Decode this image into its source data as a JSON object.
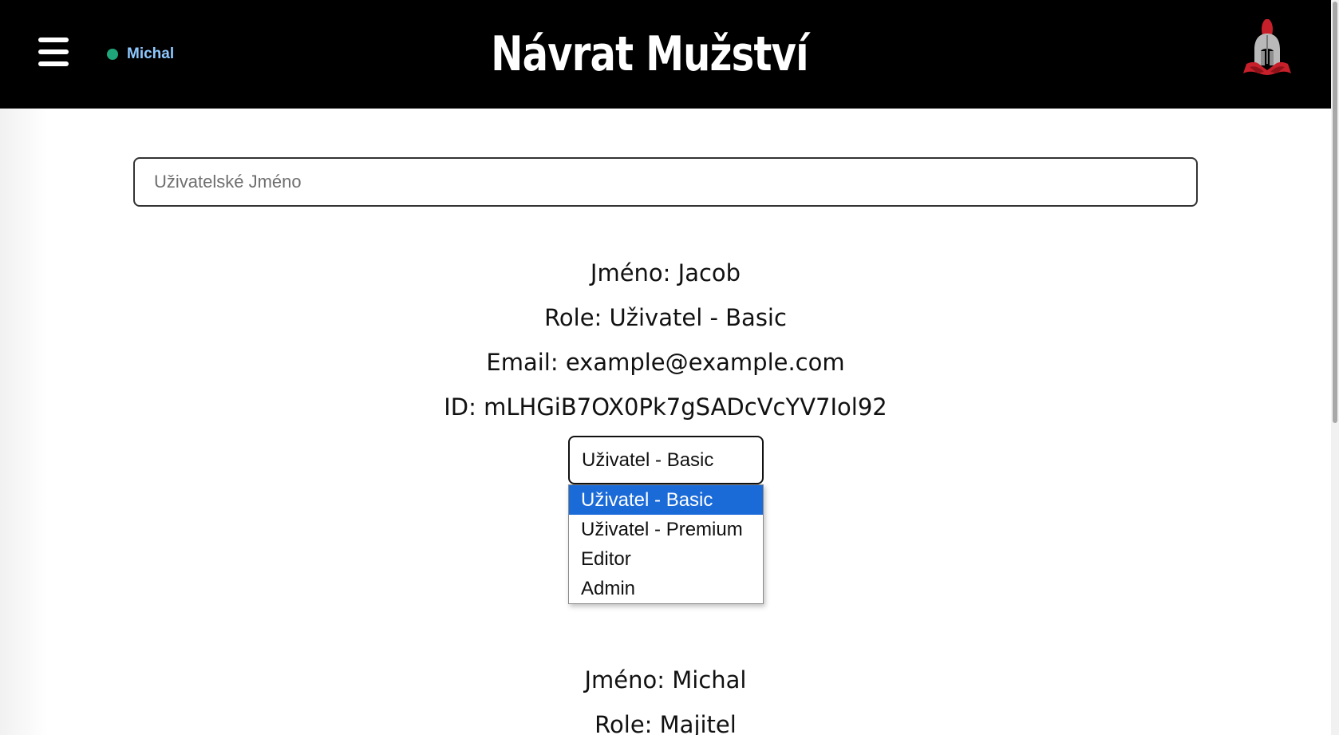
{
  "header": {
    "title": "Návrat Mužství",
    "user_name": "Michal",
    "icons": {
      "menu": "hamburger-menu-icon",
      "status": "online-status-dot",
      "logo": "spartan-helmet-logo"
    },
    "colors": {
      "background": "#000000",
      "user_name": "#8ec8ff",
      "online_dot": "#1fa67a"
    }
  },
  "search": {
    "placeholder": "Uživatelské Jméno",
    "value": ""
  },
  "users": [
    {
      "name_line": "Jméno: Jacob",
      "role_line": "Role: Uživatel - Basic",
      "email_line": "Email: example@example.com",
      "id_line": "ID: mLHGiB7OX0Pk7gSADcVcYV7Iol92",
      "role_select": {
        "selected": "Uživatel - Basic",
        "expanded": true,
        "options": [
          "Uživatel - Basic",
          "Uživatel - Premium",
          "Editor",
          "Admin"
        ],
        "highlight_color": "#1a6ad8"
      }
    },
    {
      "name_line": "Jméno: Michal",
      "role_line": "Role: Majitel"
    }
  ]
}
